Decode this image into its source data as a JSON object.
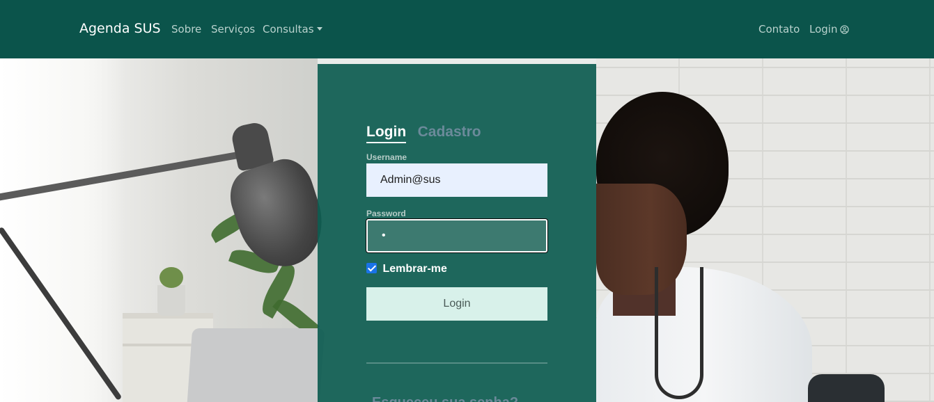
{
  "navbar": {
    "brand": "Agenda SUS",
    "links": [
      "Sobre",
      "Serviços",
      "Consultas"
    ],
    "right_links": [
      "Contato",
      "Login"
    ]
  },
  "login_form": {
    "tabs": [
      "Login",
      "Cadastro"
    ],
    "username_label": "Username",
    "username_value": "Admin@sus",
    "password_label": "Password",
    "password_value": "•",
    "remember_label": "Lembrar-me",
    "remember_checked": true,
    "submit_label": "Login",
    "forgot_label": "Esqueceu sua senha?"
  },
  "colors": {
    "navbar_bg": "#0b544b",
    "card_bg": "#0e5c51",
    "button_bg": "#d8f1ea",
    "checkbox": "#1a73e8"
  }
}
